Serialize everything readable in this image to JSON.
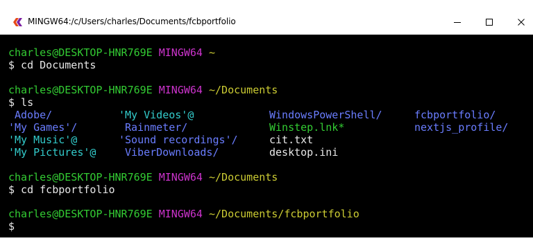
{
  "window": {
    "title": "MINGW64:/c/Users/charles/Documents/fcbportfolio",
    "minimize_glyph": "—",
    "maximize_glyph": "☐",
    "close_glyph": "✕"
  },
  "colors": {
    "user": "#33cc33",
    "system": "#cc33cc",
    "path": "#cccc33",
    "text": "#e8e8e8",
    "directory": "#6a7dff",
    "symlink": "#33cccc",
    "executable": "#33cc33"
  },
  "terminal": {
    "prompt1": {
      "user": "charles@DESKTOP-HNR769E",
      "sys": "MINGW64",
      "path": "~"
    },
    "cmd1": "$ cd Documents",
    "prompt2": {
      "user": "charles@DESKTOP-HNR769E",
      "sys": "MINGW64",
      "path": "~/Documents"
    },
    "cmd2": "$ ls",
    "ls": [
      {
        "name": "Adobe/",
        "type": "directory"
      },
      {
        "name": "'My Games'/",
        "type": "directory"
      },
      {
        "name": "'My Music'@",
        "type": "symlink"
      },
      {
        "name": "'My Pictures'@",
        "type": "symlink"
      },
      {
        "name": "'My Videos'@",
        "type": "symlink"
      },
      {
        "name": "Rainmeter/",
        "type": "directory"
      },
      {
        "name": "'Sound recordings'/",
        "type": "directory"
      },
      {
        "name": "ViberDownloads/",
        "type": "directory"
      },
      {
        "name": "WindowsPowerShell/",
        "type": "directory"
      },
      {
        "name": "Winstep.lnk*",
        "type": "executable"
      },
      {
        "name": "cit.txt",
        "type": "file"
      },
      {
        "name": "desktop.ini",
        "type": "file"
      },
      {
        "name": "fcbportfolio/",
        "type": "directory"
      },
      {
        "name": "nextjs_profile/",
        "type": "directory"
      }
    ],
    "prompt3": {
      "user": "charles@DESKTOP-HNR769E",
      "sys": "MINGW64",
      "path": "~/Documents"
    },
    "cmd3": "$ cd fcbportfolio",
    "prompt4": {
      "user": "charles@DESKTOP-HNR769E",
      "sys": "MINGW64",
      "path": "~/Documents/fcbportfolio"
    },
    "cmd4": "$"
  }
}
